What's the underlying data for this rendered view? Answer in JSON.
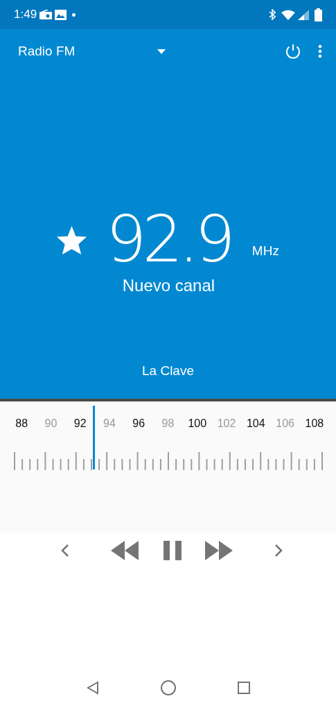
{
  "status_bar": {
    "time": "1:49"
  },
  "app_bar": {
    "title": "Radio FM"
  },
  "station": {
    "favorite": true,
    "frequency": "92.9",
    "unit": "MHz",
    "name": "Nuevo canal",
    "rds": "La Clave"
  },
  "tuner": {
    "level": 0.26,
    "labels": [
      {
        "text": "88",
        "kind": "major"
      },
      {
        "text": "90",
        "kind": "minor"
      },
      {
        "text": "92",
        "kind": "major"
      },
      {
        "text": "94",
        "kind": "minor"
      },
      {
        "text": "96",
        "kind": "major"
      },
      {
        "text": "98",
        "kind": "minor"
      },
      {
        "text": "100",
        "kind": "major"
      },
      {
        "text": "102",
        "kind": "minor"
      },
      {
        "text": "104",
        "kind": "major"
      },
      {
        "text": "106",
        "kind": "minor"
      },
      {
        "text": "108",
        "kind": "major"
      }
    ]
  },
  "controls": {
    "playing": true
  }
}
